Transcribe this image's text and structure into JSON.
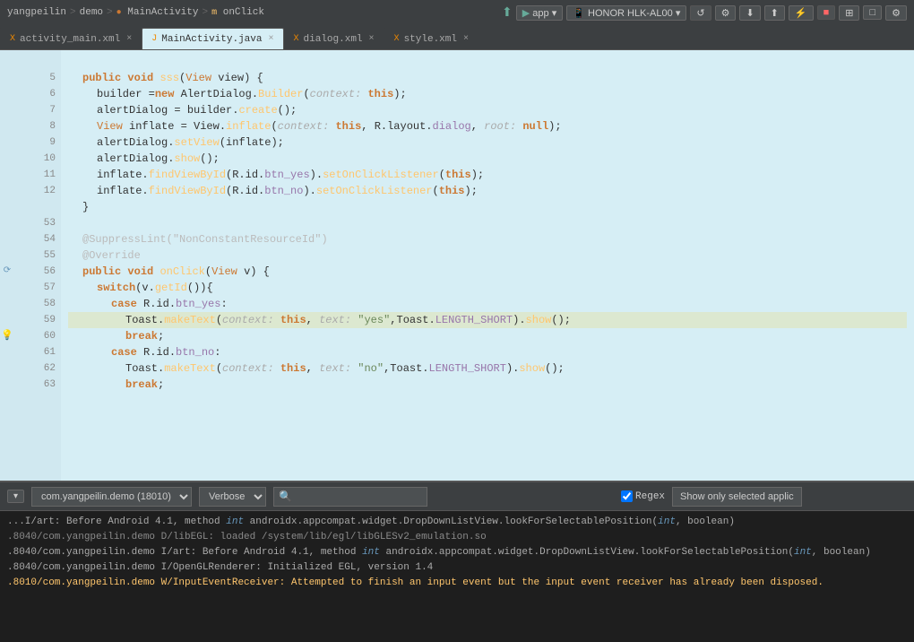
{
  "topbar": {
    "breadcrumb": {
      "project": "yangpeilin",
      "module": "demo",
      "class": "MainActivity",
      "method": "onClick"
    },
    "run_config": "app",
    "device": "HONOR HLK-AL00"
  },
  "tabs": [
    {
      "id": "activity_main",
      "label": "activity_main.xml",
      "icon": "xml",
      "active": false
    },
    {
      "id": "main_activity",
      "label": "MainActivity.java",
      "icon": "java",
      "active": true
    },
    {
      "id": "dialog",
      "label": "dialog.xml",
      "icon": "xml",
      "active": false
    },
    {
      "id": "style",
      "label": "style.xml",
      "icon": "xml",
      "active": false
    }
  ],
  "code": {
    "lines": [
      {
        "num": "",
        "content": ""
      },
      {
        "num": "5",
        "content": "    public void sss(View view) {"
      },
      {
        "num": "6",
        "content": "        builder = new AlertDialog.Builder( context: this);"
      },
      {
        "num": "7",
        "content": "        alertDialog = builder.create();"
      },
      {
        "num": "8",
        "content": "        View inflate = View.inflate( context: this, R.layout.dialog,  root: null);"
      },
      {
        "num": "9",
        "content": "        alertDialog.setView(inflate);"
      },
      {
        "num": "10",
        "content": "        alertDialog.show();"
      },
      {
        "num": "11",
        "content": "        inflate.findViewById(R.id.btn_yes).setOnClickListener(this);"
      },
      {
        "num": "12",
        "content": "        inflate.findViewById(R.id.btn_no).setOnClickListener(this);"
      },
      {
        "num": "    ",
        "content": "    }"
      },
      {
        "num": "53",
        "content": ""
      },
      {
        "num": "54",
        "content": "    @SuppressLint(\"NonConstantResourceId\")"
      },
      {
        "num": "55",
        "content": "    @Override"
      },
      {
        "num": "56",
        "content": "    public void onClick(View v) {"
      },
      {
        "num": "57",
        "content": "        switch (v.getId()){"
      },
      {
        "num": "58",
        "content": "            case R.id.btn_yes:"
      },
      {
        "num": "59",
        "content": "                Toast.makeText( context: this, text: \"yes\",Toast.LENGTH_SHORT).show();"
      },
      {
        "num": "60",
        "content": "                break;"
      },
      {
        "num": "61",
        "content": "            case R.id.btn_no:"
      },
      {
        "num": "62",
        "content": "                Toast.makeText( context: this, text: \"no\",Toast.LENGTH_SHORT).show();"
      },
      {
        "num": "63",
        "content": "                break;"
      }
    ]
  },
  "logcat": {
    "process": "com.yangpeilin.demo (18010)",
    "level": "Verbose",
    "search_placeholder": "",
    "regex_label": "Regex",
    "regex_checked": true,
    "show_only_selected": "Show only selected applic",
    "lines": [
      {
        "type": "info",
        "text": "I/art: Before Android 4.1, method int androidx.appcompat.widget.DropDownListView.lookForSelectablePosition(int, boolean)"
      },
      {
        "type": "info",
        "text": "I/OpenGLRenderer: Initialized EGL, version 1.4"
      },
      {
        "type": "warning",
        "text": "W/InputEventReceiver: Attempted to finish an input event but the input event receiver has already been disposed."
      }
    ],
    "prefix_lines": [
      {
        "text": "I/art: Before Android 4.1, method int androidx.appcompat.widget.DropDownListView.lookForSelectablePosition(int, boolean)"
      },
      {
        "text": ".8040/com.yangpeilin.demo D/libEGL: loaded /system/lib/egl/libGLESv2_emulation.so"
      },
      {
        "text": ".8040/com.yangpeilin.demo"
      }
    ]
  }
}
